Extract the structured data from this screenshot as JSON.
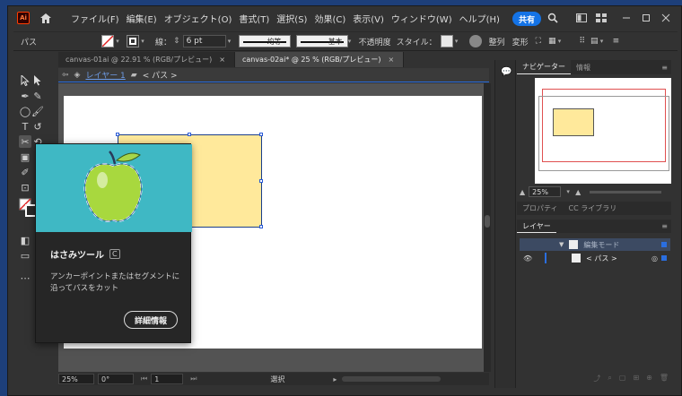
{
  "app": {
    "logo": "Ai"
  },
  "menubar": {
    "items": [
      "ファイル(F)",
      "編集(E)",
      "オブジェクト(O)",
      "書式(T)",
      "選択(S)",
      "効果(C)",
      "表示(V)",
      "ウィンドウ(W)",
      "ヘルプ(H)"
    ],
    "share_label": "共有"
  },
  "control_bar": {
    "object_type": "パス",
    "stroke_label": "線：",
    "stroke_weight": "6 pt",
    "profile_label": "均等",
    "brush_label": "基本",
    "opacity_label": "不透明度",
    "style_label": "スタイル：",
    "align_label": "整列",
    "transform_label": "変形"
  },
  "document_tabs": [
    {
      "label": "canvas-01ai @ 22.91 % (RGB/プレビュー)",
      "close": "×",
      "active": false
    },
    {
      "label": "canvas-02ai* @ 25 % (RGB/プレビュー)",
      "close": "×",
      "active": true
    }
  ],
  "breadcrumb": {
    "layer": "レイヤー 1",
    "path": "< パス >"
  },
  "status_bar": {
    "zoom": "25%",
    "rotation": "0°",
    "artboard": "1",
    "tool_status": "選択"
  },
  "navigator": {
    "tabs": [
      "ナビゲーター",
      "情報"
    ],
    "zoom": "25%"
  },
  "properties_tabs": [
    "プロパティ",
    "CC ライブラリ"
  ],
  "layers_panel": {
    "title": "レイヤー",
    "rows": [
      {
        "label": "編集モード"
      },
      {
        "label": "< パス >"
      }
    ]
  },
  "tooltip": {
    "title": "はさみツール",
    "shortcut": "C",
    "description": "アンカーポイントまたはセグメントに沿ってパスをカット",
    "button": "詳細情報"
  },
  "colors": {
    "canvas_rect_fill": "#ffe99b",
    "accent": "#1473e6",
    "tooltip_bg": "#3fb8c4"
  }
}
